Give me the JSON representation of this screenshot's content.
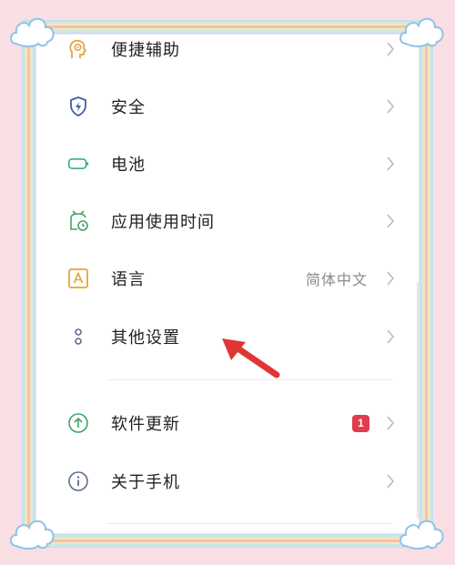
{
  "settings_list": {
    "items": [
      {
        "label": "便捷辅助",
        "icon": "accessibility-icon"
      },
      {
        "label": "安全",
        "icon": "security-shield-icon"
      },
      {
        "label": "电池",
        "icon": "battery-icon"
      },
      {
        "label": "应用使用时间",
        "icon": "app-usage-time-icon"
      },
      {
        "label": "语言",
        "icon": "language-icon",
        "value": "简体中文"
      },
      {
        "label": "其他设置",
        "icon": "more-settings-icon"
      }
    ],
    "items_after_divider": [
      {
        "label": "软件更新",
        "icon": "software-update-icon",
        "badge": "1"
      },
      {
        "label": "关于手机",
        "icon": "about-phone-icon"
      }
    ]
  },
  "colors": {
    "accent_orange": "#e8a33a",
    "shield_blue": "#3f5fa8",
    "battery_teal": "#2aa58a",
    "update_green": "#3fa36a",
    "about_blue": "#5a6d8c",
    "badge_red": "#e23b4e",
    "annotation_arrow_red": "#e03535",
    "background_pink": "#f9dfe4"
  },
  "annotation": {
    "arrow_icon": "red-pointer-arrow-icon"
  }
}
